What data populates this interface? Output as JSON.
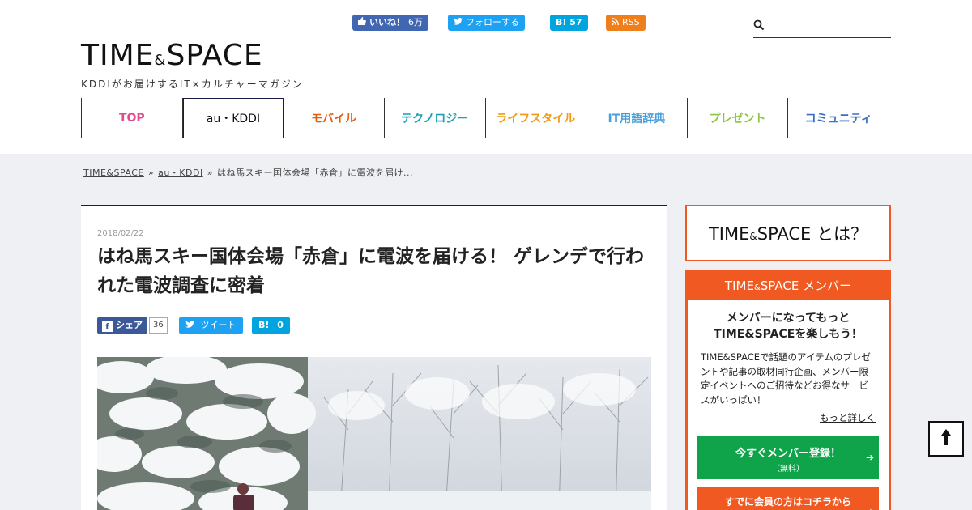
{
  "header": {
    "social": {
      "facebook_label": "いいね！",
      "facebook_count": "6万",
      "twitter_label": "フォローする",
      "hatena_label": "B!",
      "hatena_count": "57",
      "rss_label": "RSS"
    },
    "search": {
      "value": "",
      "placeholder": ""
    },
    "logo": {
      "main_left": "TIME",
      "amp": "&",
      "main_right": "SPACE",
      "tagline": "KDDIがお届けするIT×カルチャーマガジン"
    }
  },
  "nav": {
    "items": [
      {
        "label": "TOP",
        "color": "#e4478b"
      },
      {
        "label": "au・KDDI",
        "color": "#111111"
      },
      {
        "label": "モバイル",
        "color": "#e95d0f"
      },
      {
        "label": "テクノロジー",
        "color": "#1aa0b8"
      },
      {
        "label": "ライフスタイル",
        "color": "#f09a16"
      },
      {
        "label": "IT用語辞典",
        "color": "#4a9fd8"
      },
      {
        "label": "プレゼント",
        "color": "#8cc63f"
      },
      {
        "label": "コミュニティ",
        "color": "#3d6fc4"
      }
    ],
    "active_index": 1
  },
  "breadcrumb": {
    "home": "TIME&SPACE",
    "sep1": "»",
    "category": "au・KDDI",
    "sep2": "»",
    "current": "はね馬スキー国体会場「赤倉」に電波を届け..."
  },
  "article": {
    "date": "2018/02/22",
    "title": "はね馬スキー国体会場「赤倉」に電波を届ける！ ゲレンデで行われた電波調査に密着",
    "share": {
      "facebook_label": "シェア",
      "facebook_count": "36",
      "twitter_label": "ツイート",
      "hatena_label": "B!",
      "hatena_count": "0"
    }
  },
  "sidebar": {
    "about": {
      "left": "TIME",
      "amp": "&",
      "right": "SPACE",
      "suffix": "とは？"
    },
    "member": {
      "heading_left": "TIME",
      "heading_amp": "&",
      "heading_right": "SPACE メンバー",
      "lead_line1": "メンバーになってもっと",
      "lead_line2": "TIME&SPACEを楽しもう！",
      "description": "TIME&SPACEで話題のアイテムのプレゼントや記事の取材同行企画、メンバー限定イベントへのご招待などお得なサービスがいっぱい！",
      "more_link": "もっと詳しく",
      "register_main": "今すぐメンバー登録！",
      "register_sub": "（無料）",
      "login_label": "すでに会員の方はコチラから"
    }
  },
  "to_top_label": "↑",
  "colors": {
    "accent_orange": "#f05a22",
    "navy": "#1b1b4a",
    "register_green": "#0fa34a"
  }
}
